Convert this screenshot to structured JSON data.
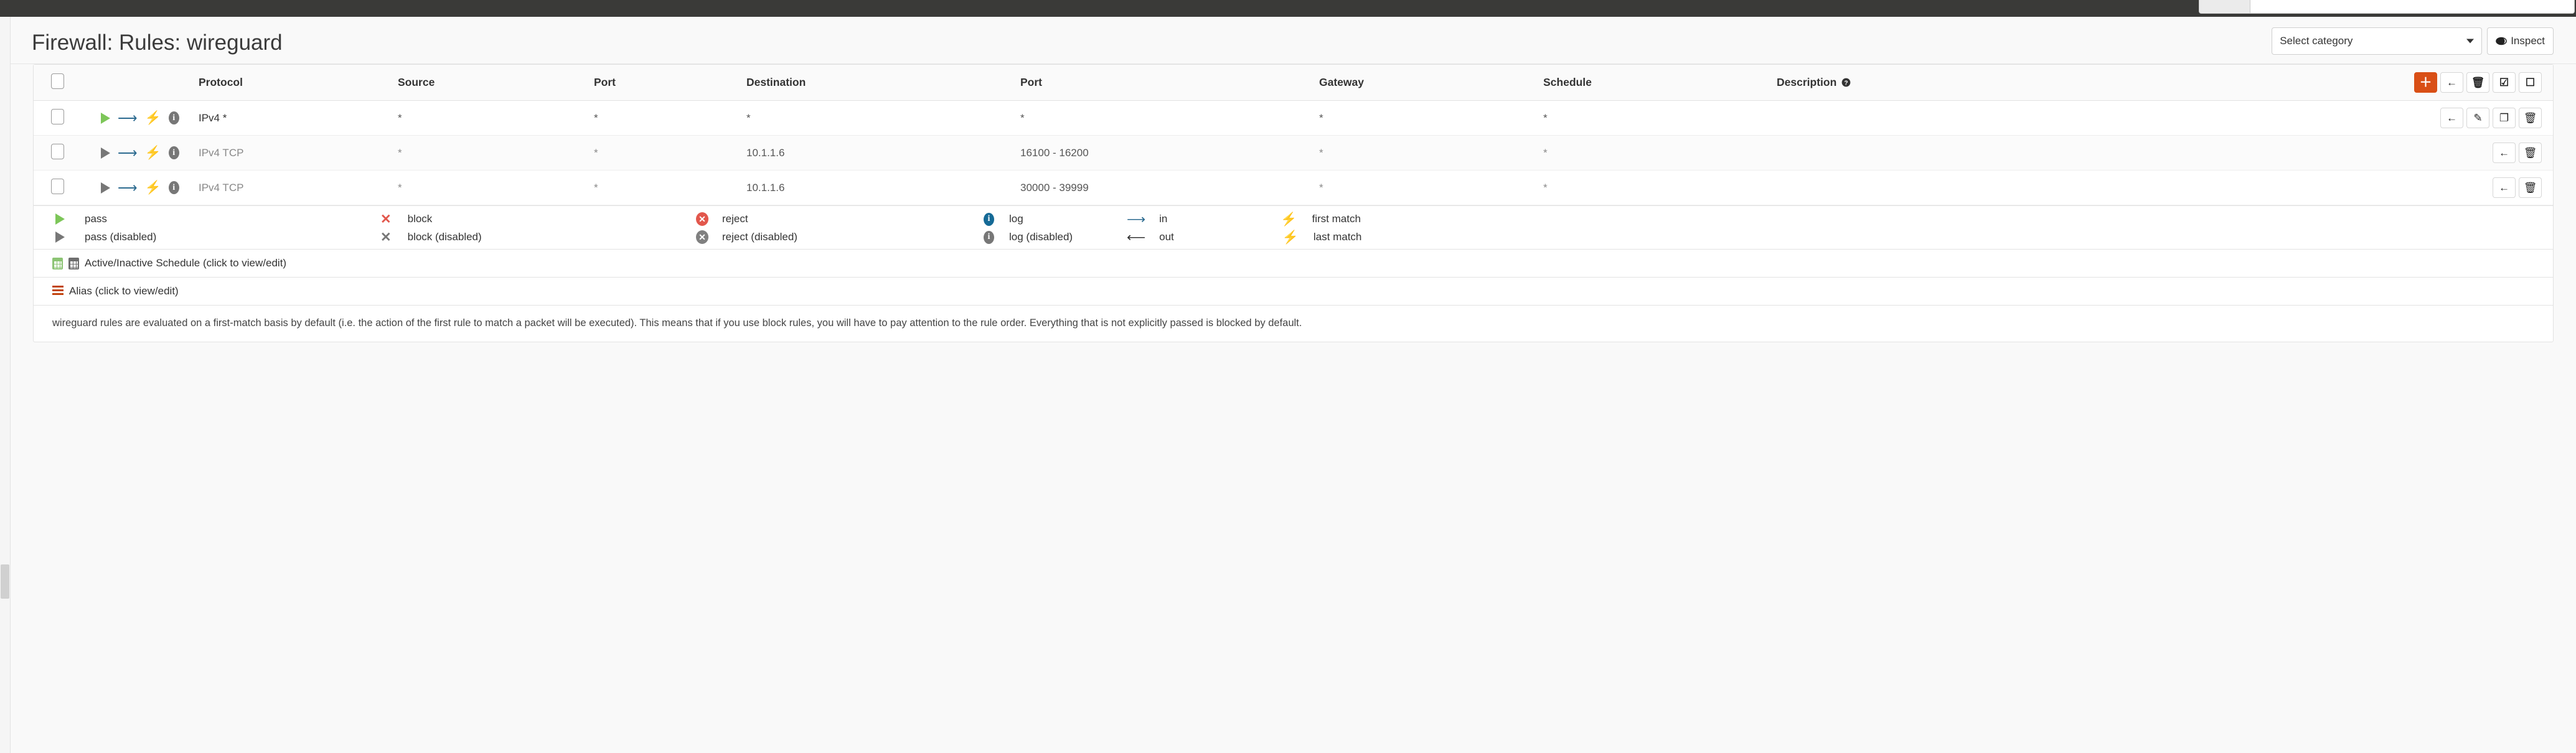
{
  "topbar": {
    "search_placeholder": "",
    "search_value": ""
  },
  "header": {
    "title": "Firewall: Rules: wireguard",
    "select_category": "Select category",
    "inspect_label": "Inspect",
    "inspect_icon": "eye-icon",
    "caret_icon": "chevron-down-icon"
  },
  "table": {
    "columns": [
      {
        "key": "check",
        "label": ""
      },
      {
        "key": "icons",
        "label": ""
      },
      {
        "key": "protocol",
        "label": "Protocol"
      },
      {
        "key": "source",
        "label": "Source"
      },
      {
        "key": "sport",
        "label": "Port"
      },
      {
        "key": "destination",
        "label": "Destination"
      },
      {
        "key": "dport",
        "label": "Port"
      },
      {
        "key": "gateway",
        "label": "Gateway"
      },
      {
        "key": "schedule",
        "label": "Schedule"
      },
      {
        "key": "description",
        "label": "Description"
      }
    ],
    "description_help_icon": "question-circle-icon",
    "header_actions": [
      {
        "name": "add-rule-button",
        "icon": "plus-icon",
        "glyph": "＋",
        "style": "primary"
      },
      {
        "name": "move-rules-button",
        "icon": "arrow-left-icon",
        "glyph": "←",
        "style": "default"
      },
      {
        "name": "delete-rules-button",
        "icon": "trash-icon",
        "glyph": "🗑",
        "style": "default"
      },
      {
        "name": "select-all-button",
        "icon": "checkbox-checked-icon",
        "glyph": "☑",
        "style": "default"
      },
      {
        "name": "deselect-all-button",
        "icon": "checkbox-empty-icon",
        "glyph": "☐",
        "style": "default"
      }
    ],
    "rows": [
      {
        "enabled": true,
        "protocol": "IPv4 *",
        "source": "*",
        "sport": "*",
        "destination": "*",
        "dport": "*",
        "gateway": "*",
        "schedule": "*",
        "description": "",
        "actions": [
          {
            "name": "move-rule-button",
            "icon": "arrow-left-icon",
            "glyph": "←"
          },
          {
            "name": "edit-rule-button",
            "icon": "pencil-icon",
            "glyph": "✎"
          },
          {
            "name": "copy-rule-button",
            "icon": "copy-icon",
            "glyph": "❐"
          },
          {
            "name": "delete-rule-button",
            "icon": "trash-icon",
            "glyph": "🗑"
          }
        ]
      },
      {
        "enabled": false,
        "protocol": "IPv4 TCP",
        "source": "*",
        "sport": "*",
        "destination": "10.1.1.6",
        "dport": "16100 - 16200",
        "gateway": "*",
        "schedule": "*",
        "description": "",
        "actions": [
          {
            "name": "move-rule-button",
            "icon": "arrow-left-icon",
            "glyph": "←"
          },
          {
            "name": "delete-rule-button",
            "icon": "trash-icon",
            "glyph": "🗑"
          }
        ]
      },
      {
        "enabled": false,
        "protocol": "IPv4 TCP",
        "source": "*",
        "sport": "*",
        "destination": "10.1.1.6",
        "dport": "30000 - 39999",
        "gateway": "*",
        "schedule": "*",
        "description": "",
        "actions": [
          {
            "name": "move-rule-button",
            "icon": "arrow-left-icon",
            "glyph": "←"
          },
          {
            "name": "delete-rule-button",
            "icon": "trash-icon",
            "glyph": "🗑"
          }
        ]
      }
    ]
  },
  "legend": {
    "row1": [
      {
        "icon": "play-icon",
        "label": "pass"
      },
      {
        "icon": "x-icon",
        "label": "block"
      },
      {
        "icon": "x-circle-icon",
        "label": "reject"
      },
      {
        "icon": "info-circle-icon",
        "label": "log"
      },
      {
        "icon": "arrow-right-icon",
        "label": "in"
      },
      {
        "icon": "bolt-icon",
        "label": "first match"
      }
    ],
    "row2": [
      {
        "icon": "play-icon",
        "label": "pass (disabled)"
      },
      {
        "icon": "x-icon",
        "label": "block (disabled)"
      },
      {
        "icon": "x-circle-icon",
        "label": "reject (disabled)"
      },
      {
        "icon": "info-circle-icon",
        "label": "log (disabled)"
      },
      {
        "icon": "arrow-left-icon",
        "label": "out"
      },
      {
        "icon": "bolt-icon",
        "label": "last match"
      }
    ]
  },
  "strips": {
    "schedule": "Active/Inactive Schedule (click to view/edit)",
    "alias": "Alias (click to view/edit)"
  },
  "note": "wireguard rules are evaluated on a first-match basis by default (i.e. the action of the first rule to match a packet will be executed). This means that if you use block rules, you will have to pay attention to the rule order. Everything that is not explicitly passed is blocked by default.",
  "colors": {
    "accent": "#d94f16",
    "pass": "#7dc659",
    "block": "#e2574c",
    "log": "#156a96",
    "bolt": "#f0ad3e",
    "disabled": "#777777",
    "topbar": "#3a3a38"
  }
}
